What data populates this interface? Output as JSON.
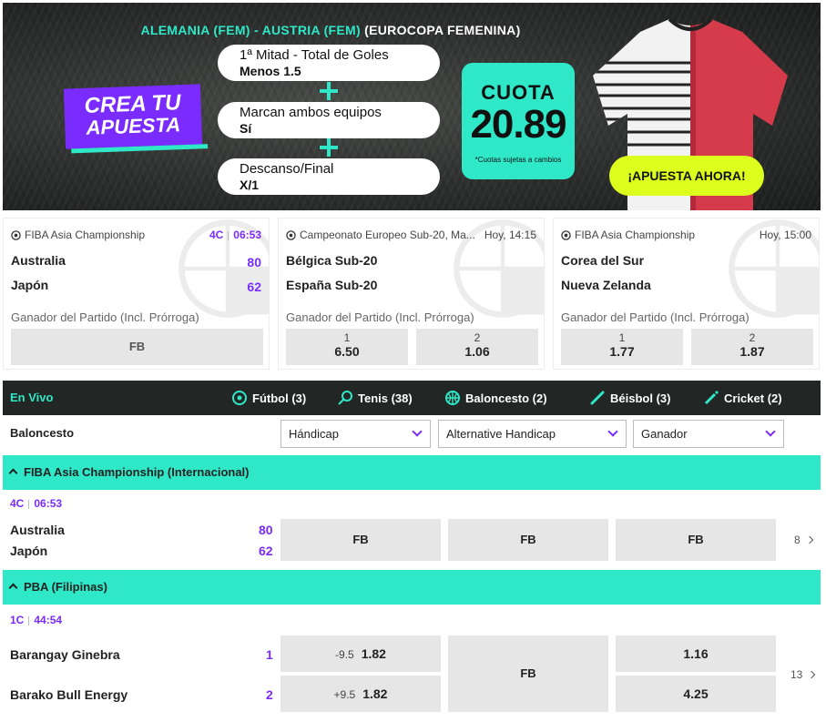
{
  "banner": {
    "match_teams": "ALEMANIA (FEM) - AUSTRIA (FEM)",
    "match_comp": "(EUROCOPA FEMENINA)",
    "crea_line1": "CREA TU",
    "crea_line2": "APUESTA",
    "selections": [
      {
        "market": "1ª Mitad - Total de Goles",
        "pick": "Menos 1.5"
      },
      {
        "market": "Marcan ambos equipos",
        "pick": "Sí"
      },
      {
        "market": "Descanso/Final",
        "pick": "X/1"
      }
    ],
    "cuota_label": "CUOTA",
    "cuota_value": "20.89",
    "cuota_note": "*Cuotas sujetas a cambios",
    "cta": "¡APUESTA AHORA!"
  },
  "cards": [
    {
      "competition": "FIBA Asia Championship",
      "live_period": "4C",
      "live_clock": "06:53",
      "time": "",
      "home": "Australia",
      "away": "Japón",
      "home_score": "80",
      "away_score": "62",
      "market": "Ganador del Partido (Incl. Prórroga)",
      "odds": [
        {
          "label": "",
          "price": "FB"
        }
      ]
    },
    {
      "competition": "Campeonato Europeo Sub-20, Ma...",
      "live_period": "",
      "live_clock": "",
      "time": "Hoy, 14:15",
      "home": "Bélgica Sub-20",
      "away": "España Sub-20",
      "home_score": "",
      "away_score": "",
      "market": "Ganador del Partido (Incl. Prórroga)",
      "odds": [
        {
          "label": "1",
          "price": "6.50"
        },
        {
          "label": "2",
          "price": "1.06"
        }
      ]
    },
    {
      "competition": "FIBA Asia Championship",
      "live_period": "",
      "live_clock": "",
      "time": "Hoy, 15:00",
      "home": "Corea del Sur",
      "away": "Nueva Zelanda",
      "home_score": "",
      "away_score": "",
      "market": "Ganador del Partido (Incl. Prórroga)",
      "odds": [
        {
          "label": "1",
          "price": "1.77"
        },
        {
          "label": "2",
          "price": "1.87"
        }
      ]
    }
  ],
  "live": {
    "label": "En Vivo",
    "sports": [
      {
        "name": "Fútbol (3)",
        "icon": "soccer-ball-icon"
      },
      {
        "name": "Tenis (38)",
        "icon": "tennis-racket-icon"
      },
      {
        "name": "Baloncesto (2)",
        "icon": "basketball-icon"
      },
      {
        "name": "Béisbol (3)",
        "icon": "baseball-bat-icon"
      },
      {
        "name": "Cricket (2)",
        "icon": "cricket-bat-icon"
      }
    ]
  },
  "filter": {
    "sport": "Baloncesto",
    "dropdowns": [
      "Hándicap",
      "Alternative Handicap",
      "Ganador"
    ]
  },
  "competitions": [
    {
      "name": "FIBA Asia Championship (Internacional)",
      "event": {
        "period": "4C",
        "clock": "06:53",
        "home": "Australia",
        "away": "Japón",
        "home_score": "80",
        "away_score": "62",
        "odds": [
          "FB",
          "FB",
          "FB"
        ],
        "more": "8"
      }
    },
    {
      "name": "PBA (Filipinas)",
      "event": {
        "period": "1C",
        "clock": "44:54",
        "home": "Barangay Ginebra",
        "away": "Barako Bull Energy",
        "home_score": "1",
        "away_score": "2",
        "handicap": [
          {
            "line": "-9.5",
            "price": "1.82"
          },
          {
            "line": "+9.5",
            "price": "1.82"
          }
        ],
        "alt": "FB",
        "winner": [
          "1.16",
          "4.25"
        ],
        "more": "13"
      }
    }
  ],
  "colors": {
    "accent": "#2ee8c8",
    "brand": "#7a2cff",
    "cta": "#dcff1e",
    "dark": "#222725"
  }
}
